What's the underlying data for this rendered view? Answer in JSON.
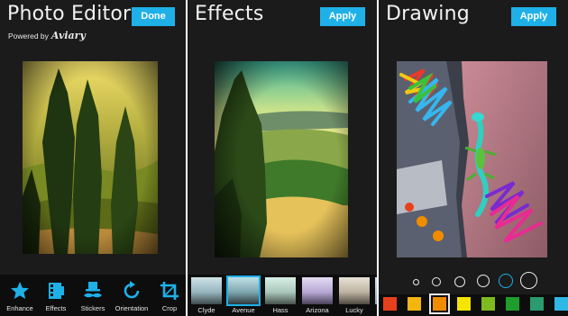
{
  "editor": {
    "title": "Photo Editor",
    "done_label": "Done",
    "powered_by": "Powered by",
    "brand": "Aviary",
    "tools": [
      {
        "label": "Enhance",
        "icon": "magic-star-icon"
      },
      {
        "label": "Effects",
        "icon": "effects-film-icon"
      },
      {
        "label": "Stickers",
        "icon": "mustache-hat-icon"
      },
      {
        "label": "Orientation",
        "icon": "rotate-icon"
      },
      {
        "label": "Crop",
        "icon": "crop-icon"
      }
    ]
  },
  "effects": {
    "title": "Effects",
    "apply_label": "Apply",
    "filters": [
      {
        "label": "Clyde",
        "selected": false
      },
      {
        "label": "Avenue",
        "selected": true
      },
      {
        "label": "Hass",
        "selected": false
      },
      {
        "label": "Arizona",
        "selected": false
      },
      {
        "label": "Lucky",
        "selected": false
      }
    ]
  },
  "drawing": {
    "title": "Drawing",
    "apply_label": "Apply",
    "brush_sizes": [
      "xs",
      "s",
      "m",
      "l",
      "xl",
      "xxl"
    ],
    "selected_brush": "xl",
    "colors": [
      "#e8401c",
      "#f5b50f",
      "#f08c00",
      "#f4e400",
      "#7dbb1e",
      "#1f9d2c",
      "#2a9b6e",
      "#2db8e6"
    ],
    "selected_color": "#f08c00"
  },
  "accent": "#1fb0e8"
}
